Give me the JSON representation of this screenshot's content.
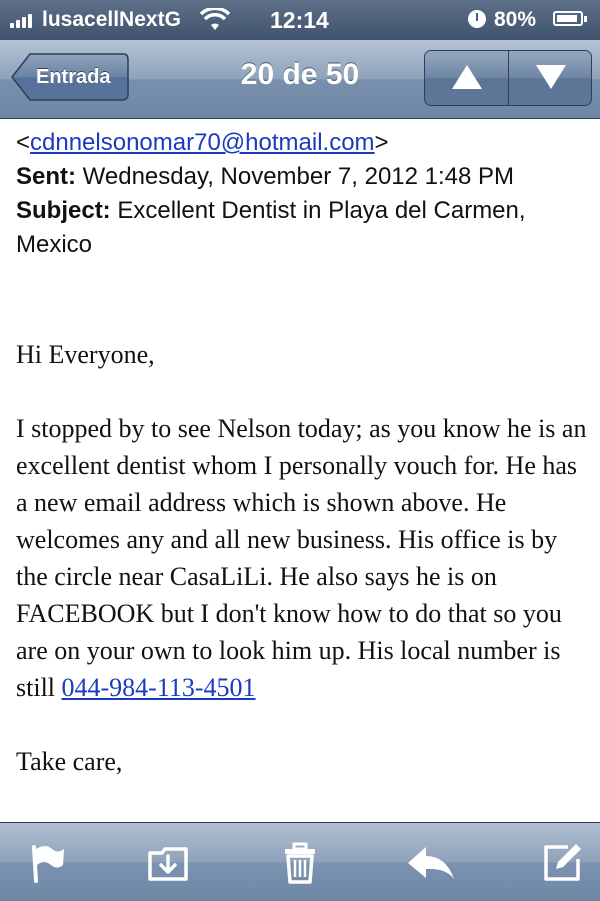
{
  "status_bar": {
    "carrier": "lusacellNextG",
    "time": "12:14",
    "battery_percent": "80%",
    "icons": [
      "signal-bars-icon",
      "wifi-icon",
      "rotation-lock-icon",
      "battery-icon"
    ]
  },
  "nav": {
    "back_label": "Entrada",
    "title": "20 de 50",
    "prev_icon": "arrow-up-icon",
    "next_icon": "arrow-down-icon"
  },
  "header": {
    "from_open": "<",
    "from_email": "cdnnelsonomar70@hotmail.com",
    "from_close": ">",
    "sent_label": "Sent:",
    "sent_value": "Wednesday, November 7, 2012 1:48 PM",
    "subject_label": "Subject:",
    "subject_value": "Excellent Dentist in Playa del Carmen, Mexico"
  },
  "message": {
    "greeting": "Hi Everyone,",
    "paragraph": "I stopped by to see Nelson today; as you know he is an excellent dentist whom I personally vouch for.  He has a new email address which is shown above.  He welcomes any and all new business.  His office is by the circle near CasaLiLi.  He also says he is on FACEBOOK but I don't know how to do that so you are on your own to look him up.  His local number is still",
    "phone": "044-984-113-4501",
    "closing": "Take care,"
  },
  "toolbar": {
    "icons": [
      "flag-icon",
      "move-folder-icon",
      "trash-icon",
      "reply-icon",
      "compose-icon"
    ]
  }
}
